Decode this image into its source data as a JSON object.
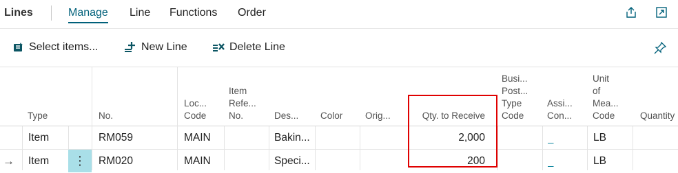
{
  "header": {
    "title": "Lines",
    "tabs": [
      {
        "label": "Manage",
        "active": true
      },
      {
        "label": "Line"
      },
      {
        "label": "Functions"
      },
      {
        "label": "Order"
      }
    ],
    "icons": [
      "share-icon",
      "expand-icon"
    ]
  },
  "actions": {
    "select_items": "Select items...",
    "new_line": "New Line",
    "delete_line": "Delete Line",
    "pin_icon": "pin-icon"
  },
  "columns": {
    "type": "Type",
    "no": "No.",
    "location_code": "Loc...\nCode",
    "item_reference_no": "Item\nRefe...\nNo.",
    "description": "Des...",
    "color": "Color",
    "original": "Orig...",
    "qty_to_receive": "Qty. to Receive",
    "business_posting_type_code": "Busi...\nPost...\nType\nCode",
    "assigned_con": "Assi...\nCon...",
    "unit_of_measure_code": "Unit\nof\nMea...\nCode",
    "quantity": "Quantity"
  },
  "rows": [
    {
      "type": "Item",
      "no": "RM059",
      "location_code": "MAIN",
      "item_reference_no": "",
      "description": "Bakin...",
      "color": "",
      "original": "",
      "qty_to_receive": "2,000",
      "business_posting_type_code": "",
      "assigned_con": "_",
      "unit_of_measure_code": "LB",
      "quantity": ""
    },
    {
      "type": "Item",
      "no": "RM020",
      "location_code": "MAIN",
      "item_reference_no": "",
      "description": "Speci...",
      "color": "",
      "original": "",
      "qty_to_receive": "200",
      "business_posting_type_code": "",
      "assigned_con": "_",
      "unit_of_measure_code": "LB",
      "quantity": "",
      "current": true,
      "row_indicator": "→",
      "row_menu": "⋮"
    }
  ],
  "colors": {
    "accent": "#00607a",
    "selection": "#a9dfe8",
    "highlight": "#e00000"
  }
}
